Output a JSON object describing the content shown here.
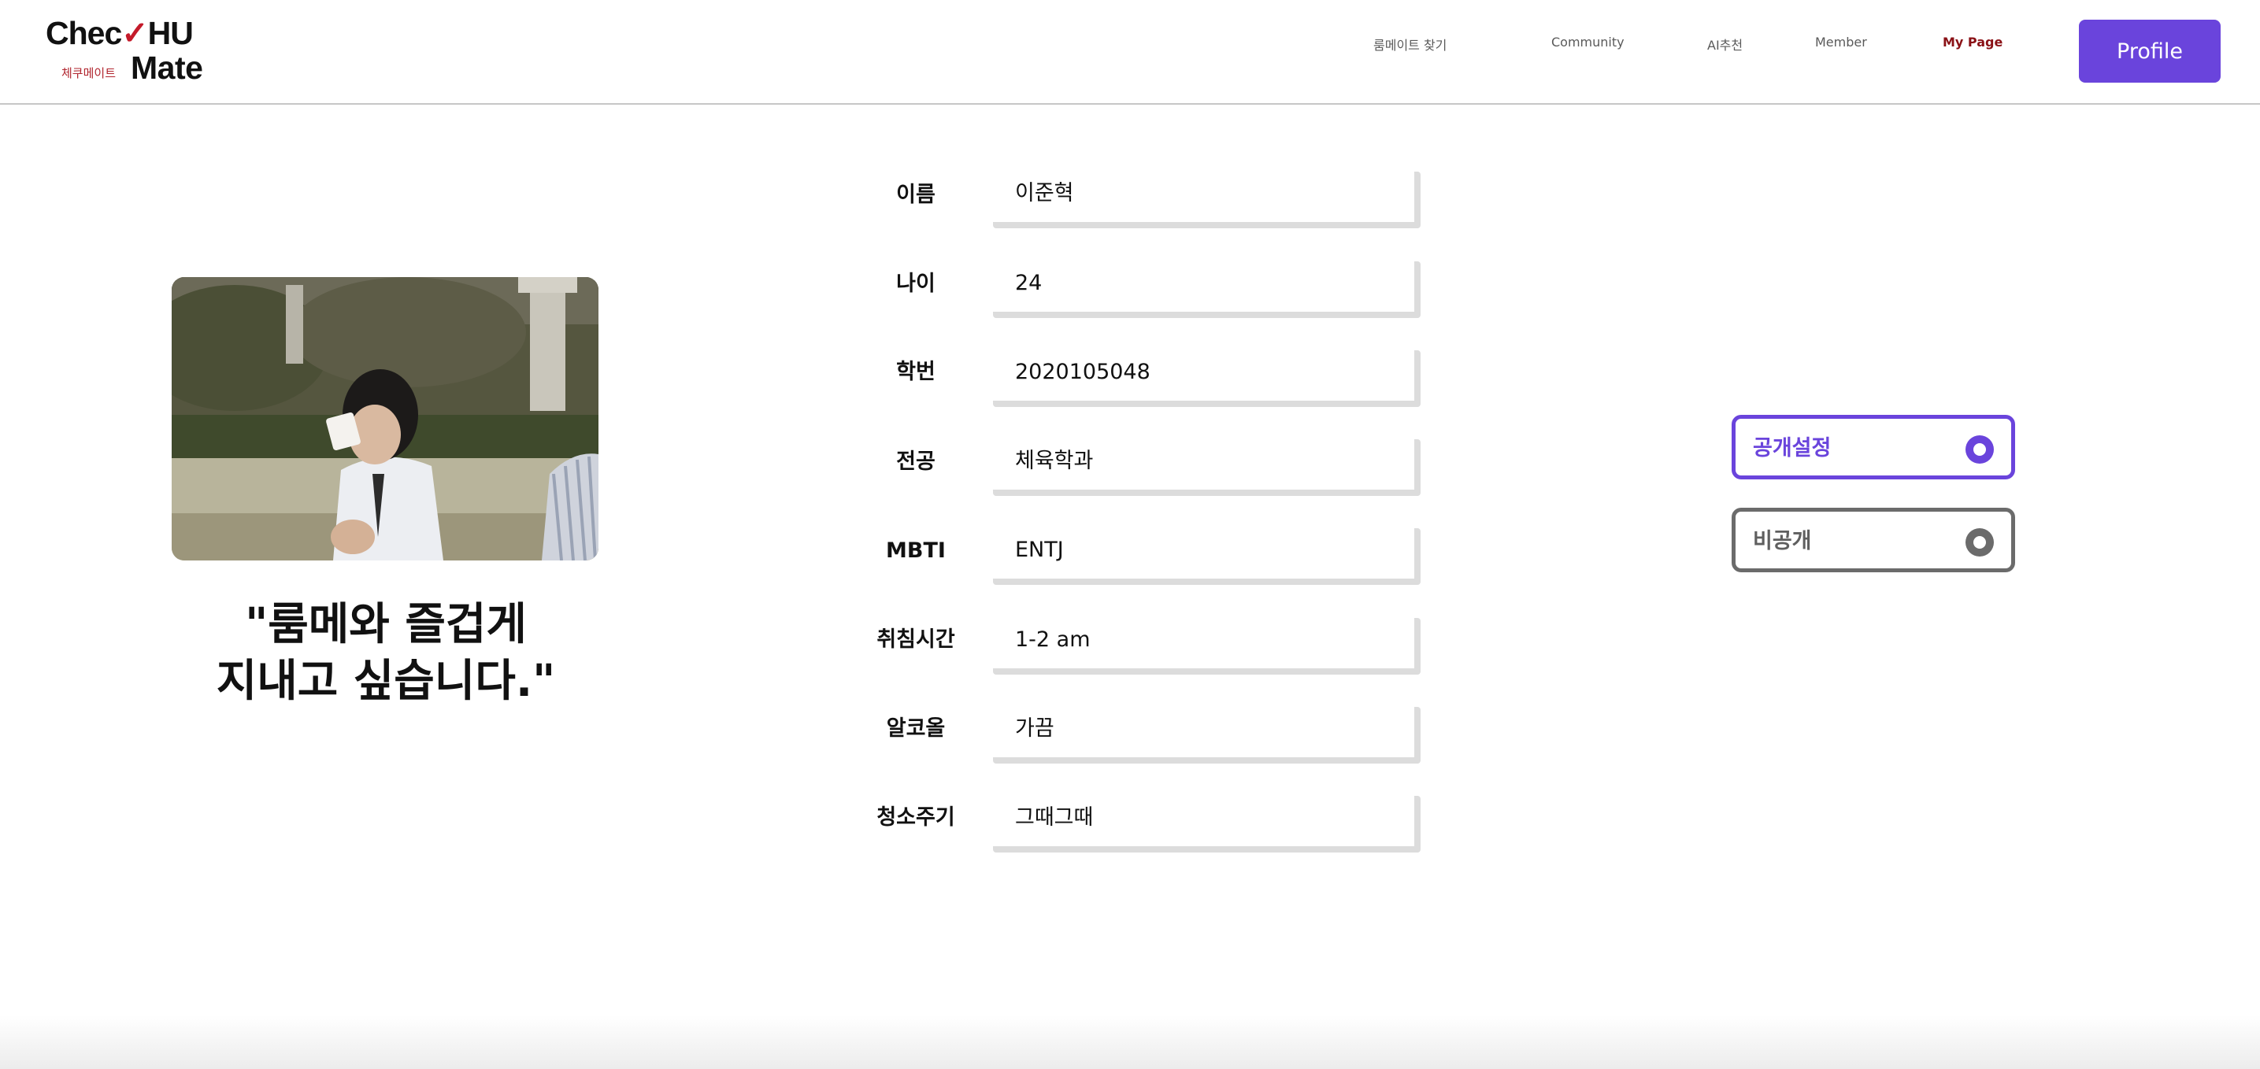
{
  "logo": {
    "prefix": "Chec",
    "check": "✓",
    "suffix": "HU",
    "line2": "Mate",
    "sub": "체쿠메이트"
  },
  "nav": {
    "items": [
      {
        "label": "룸메이트 찾기"
      },
      {
        "label": "Community"
      },
      {
        "label": "AI추천"
      },
      {
        "label": "Member"
      },
      {
        "label": "My Page"
      }
    ],
    "profile_label": "Profile"
  },
  "profile": {
    "quote_line1": "\"룸메와 즐겁게",
    "quote_line2": "지내고 싶습니다.\""
  },
  "fields": [
    {
      "label": "이름",
      "value": "이준혁"
    },
    {
      "label": "나이",
      "value": "24"
    },
    {
      "label": "학번",
      "value": "2020105048"
    },
    {
      "label": "전공",
      "value": "체육학과"
    },
    {
      "label": "MBTI",
      "value": "ENTJ"
    },
    {
      "label": "취침시간",
      "value": "1-2 am"
    },
    {
      "label": "알코올",
      "value": "가끔"
    },
    {
      "label": "청소주기",
      "value": "그때그때"
    }
  ],
  "visibility": {
    "public_label": "공개설정",
    "private_label": "비공개"
  },
  "colors": {
    "accent": "#6a44dc",
    "active_nav": "#8a1116",
    "logo_red": "#c41a2a",
    "neutral_border": "#6b6b6b"
  }
}
